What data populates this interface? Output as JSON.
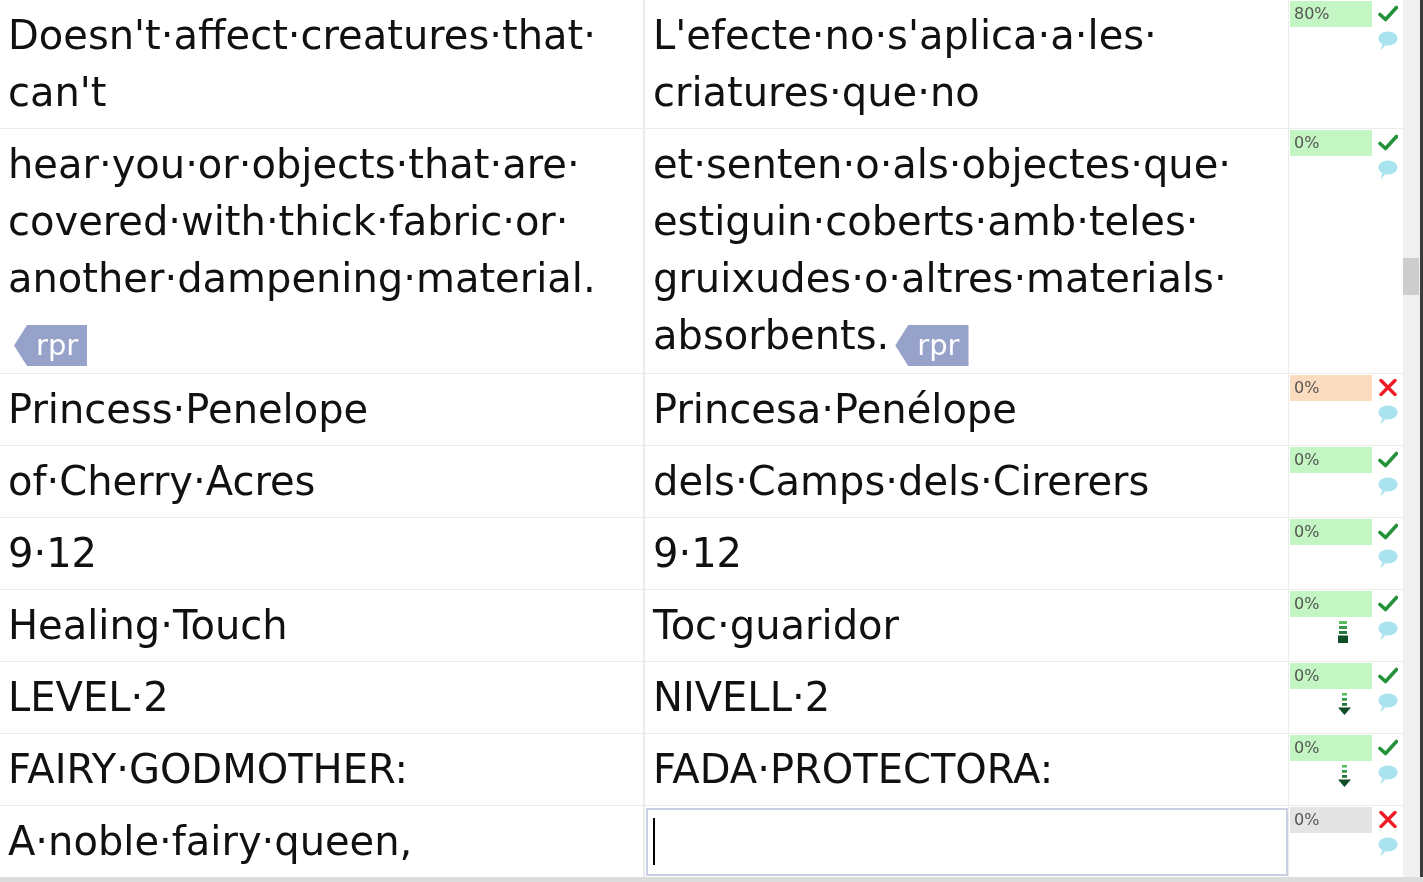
{
  "segments": [
    {
      "source": {
        "lines": [
          "Doesn't·affect·creatures·that·",
          "can't"
        ]
      },
      "target": {
        "lines": [
          "L'efecte·no·s'aplica·a·les·",
          "criatures·que·no"
        ]
      },
      "editing": false,
      "match": "80%",
      "color": "#c3f6c3",
      "confirmed": true
    },
    {
      "source": {
        "lines": [
          "hear·you·or·objects·that·are·",
          "covered·with·thick·fabric·or·",
          "another·dampening·material."
        ],
        "tag": "rpr"
      },
      "target": {
        "lines": [
          "et·senten·o·als·objectes·que·",
          "estiguin·coberts·amb·teles·",
          "gruixudes·o·altres·materials·",
          "absorbents."
        ],
        "tag": "rpr"
      },
      "editing": false,
      "match": "0%",
      "color": "#c3f6c3",
      "confirmed": true
    },
    {
      "source": {
        "lines": [
          "Princess·Penelope"
        ]
      },
      "target": {
        "lines": [
          "Princesa·Penélope"
        ]
      },
      "editing": false,
      "match": "0%",
      "color": "#fcdcbf",
      "confirmed": false
    },
    {
      "source": {
        "lines": [
          "of·Cherry·Acres"
        ]
      },
      "target": {
        "lines": [
          "dels·Camps·dels·Cirerers"
        ]
      },
      "editing": false,
      "match": "0%",
      "color": "#c3f6c3",
      "confirmed": true
    },
    {
      "source": {
        "lines": [
          "9·12"
        ]
      },
      "target": {
        "lines": [
          "9·12"
        ]
      },
      "editing": false,
      "match": "0%",
      "color": "#c3f6c3",
      "confirmed": true
    },
    {
      "source": {
        "lines": [
          "Healing·Touch"
        ]
      },
      "target": {
        "lines": [
          "Toc·guaridor"
        ]
      },
      "editing": false,
      "match": "0%",
      "color": "#c3f6c3",
      "confirmed": true,
      "marker": {
        "kind": "bars"
      }
    },
    {
      "source": {
        "lines": [
          "LEVEL·2"
        ]
      },
      "target": {
        "lines": [
          "NIVELL·2"
        ]
      },
      "editing": false,
      "match": "0%",
      "color": "#c3f6c3",
      "confirmed": true,
      "marker": {
        "kind": "arrow"
      }
    },
    {
      "source": {
        "lines": [
          "FAIRY·GODMOTHER:"
        ]
      },
      "target": {
        "lines": [
          "FADA·PROTECTORA:"
        ]
      },
      "editing": false,
      "match": "0%",
      "color": "#c3f6c3",
      "confirmed": true,
      "marker": {
        "kind": "arrow"
      }
    },
    {
      "source": {
        "lines": [
          "A·noble·fairy·queen,"
        ]
      },
      "editing": true,
      "match": "0%",
      "color": "#e4e4e4",
      "confirmed": false
    }
  ]
}
